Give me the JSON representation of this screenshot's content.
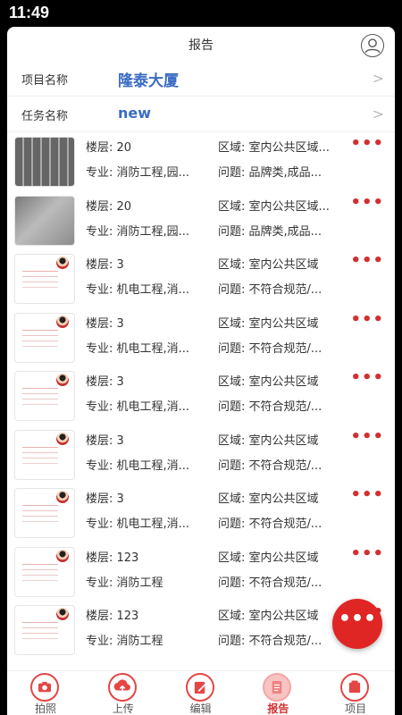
{
  "status_bar": {
    "time": "11:49"
  },
  "header": {
    "title": "报告"
  },
  "project": {
    "label": "项目名称",
    "value": "隆泰大厦"
  },
  "task": {
    "label": "任务名称",
    "value": "new"
  },
  "items": [
    {
      "thumb": "keyboard",
      "floor": "楼层: 20",
      "area": "区域: 室内公共区域...",
      "major": "专业: 消防工程,园...",
      "issue": "问题: 品牌类,成品..."
    },
    {
      "thumb": "paper",
      "floor": "楼层: 20",
      "area": "区域: 室内公共区域...",
      "major": "专业: 消防工程,园...",
      "issue": "问题: 品牌类,成品..."
    },
    {
      "thumb": "doc",
      "floor": "楼层: 3",
      "area": "区域: 室内公共区域",
      "major": "专业: 机电工程,消...",
      "issue": "问题: 不符合规范/..."
    },
    {
      "thumb": "doc",
      "floor": "楼层: 3",
      "area": "区域: 室内公共区域",
      "major": "专业: 机电工程,消...",
      "issue": "问题: 不符合规范/..."
    },
    {
      "thumb": "doc",
      "floor": "楼层: 3",
      "area": "区域: 室内公共区域",
      "major": "专业: 机电工程,消...",
      "issue": "问题: 不符合规范/..."
    },
    {
      "thumb": "doc",
      "floor": "楼层: 3",
      "area": "区域: 室内公共区域",
      "major": "专业: 机电工程,消...",
      "issue": "问题: 不符合规范/..."
    },
    {
      "thumb": "doc",
      "floor": "楼层: 3",
      "area": "区域: 室内公共区域",
      "major": "专业: 机电工程,消...",
      "issue": "问题: 不符合规范/..."
    },
    {
      "thumb": "doc",
      "floor": "楼层: 123",
      "area": "区域: 室内公共区域",
      "major": "专业: 消防工程",
      "issue": "问题: 不符合规范/..."
    },
    {
      "thumb": "doc",
      "floor": "楼层: 123",
      "area": "区域: 室内公共区域",
      "major": "专业: 消防工程",
      "issue": "问题: 不符合规范/..."
    }
  ],
  "item_more": "•••",
  "fab": {
    "label": "•••"
  },
  "tabs": [
    {
      "label": "拍照",
      "icon": "camera-icon",
      "active": false
    },
    {
      "label": "上传",
      "icon": "upload-cloud-icon",
      "active": false
    },
    {
      "label": "编辑",
      "icon": "edit-icon",
      "active": false
    },
    {
      "label": "报告",
      "icon": "report-icon",
      "active": true
    },
    {
      "label": "项目",
      "icon": "project-icon",
      "active": false
    }
  ],
  "colors": {
    "accent": "#d32f2f",
    "link_blue": "#3a6cc4"
  }
}
